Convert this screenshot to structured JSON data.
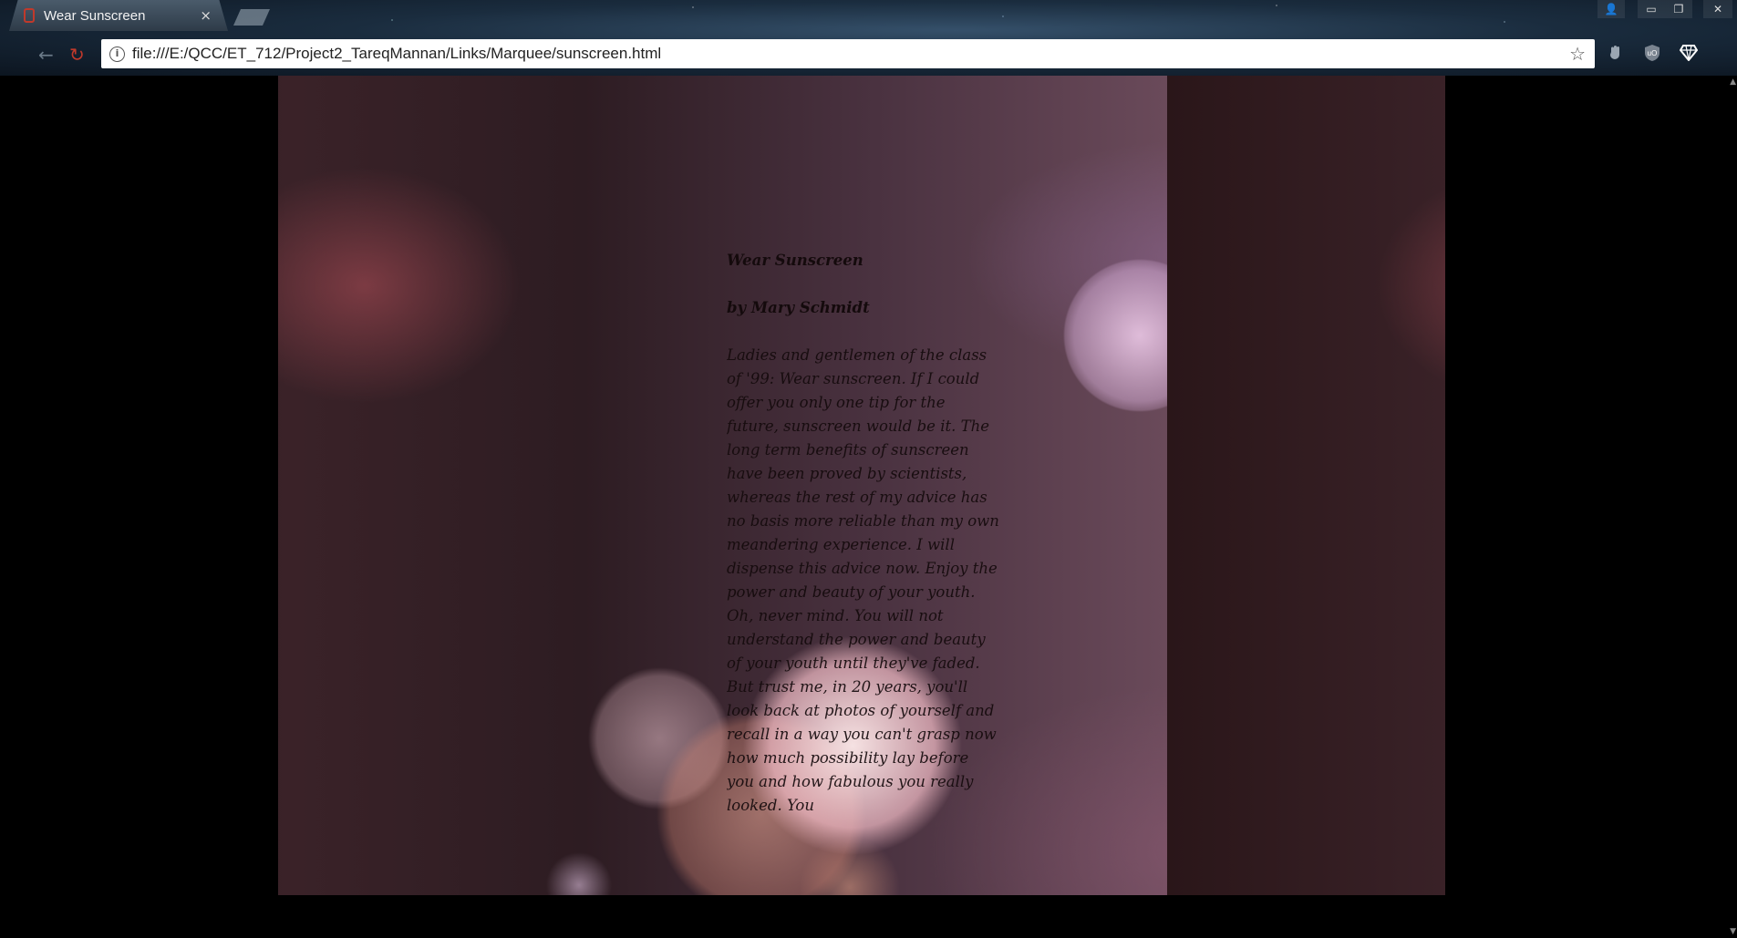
{
  "browser": {
    "tab_title": "Wear Sunscreen",
    "tab_close": "×",
    "url": "file:///E:/QCC/ET_712/Project2_TareqMannan/Links/Marquee/sunscreen.html",
    "icons": {
      "back": "back-arrow-icon",
      "reload": "reload-icon",
      "info": "info-icon",
      "star": "bookmark-star-icon",
      "extensions": [
        "extension-hand-icon",
        "ublock-shield-icon",
        "diamond-extension-icon"
      ],
      "window": [
        "user-icon",
        "minimize-icon",
        "restore-icon",
        "close-window-icon"
      ]
    }
  },
  "page": {
    "title": "Wear Sunscreen",
    "author": "by Mary Schmidt",
    "body": "Ladies and gentlemen of the class of '99: Wear sunscreen. If I could offer you only one tip for the future, sunscreen would be it. The long term benefits of sunscreen have been proved by scientists, whereas the rest of my advice has no basis more reliable than my own meandering experience. I will dispense this advice now. Enjoy the power and beauty of your youth. Oh, never mind. You will not understand the power and beauty of your youth until they've faded. But trust me, in 20 years, you'll look back at photos of yourself and recall in a way you can't grasp now how much possibility lay before you and how fabulous you really looked. You"
  },
  "colors": {
    "poem_text": "#140a0c",
    "background": "#000000",
    "reload_icon": "#c0392b"
  }
}
